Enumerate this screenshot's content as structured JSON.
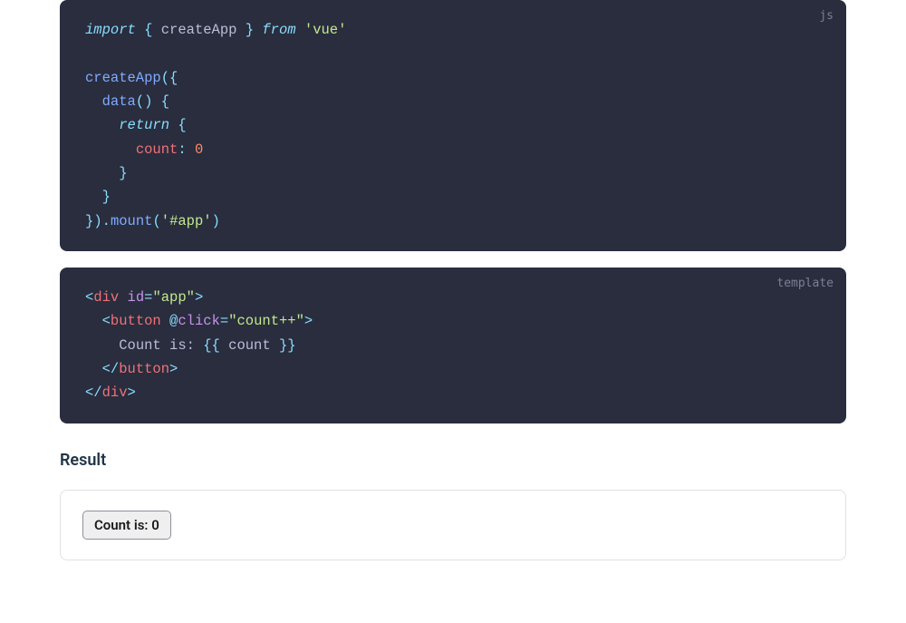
{
  "code_js": {
    "lang": "js",
    "tokens": [
      [
        [
          "import",
          " ",
          "{ ",
          "createApp",
          " }",
          " ",
          "from",
          " ",
          "'vue'"
        ],
        [
          "kw",
          "",
          "punc",
          "id",
          "punc",
          "",
          "kw",
          "",
          "str"
        ]
      ],
      [
        [
          ""
        ],
        [
          "",
          ""
        ]
      ],
      [
        [
          "createApp",
          "(",
          "{"
        ],
        [
          "fn",
          "punc",
          "punc"
        ]
      ],
      [
        [
          "  ",
          "data",
          "()",
          " ",
          "{"
        ],
        [
          "",
          "fn",
          "punc",
          "",
          "punc"
        ]
      ],
      [
        [
          "    ",
          "return",
          " ",
          "{"
        ],
        [
          "",
          "kw",
          "",
          "punc"
        ]
      ],
      [
        [
          "      ",
          "count",
          ": ",
          "0"
        ],
        [
          "",
          "prop",
          "punc",
          "num"
        ]
      ],
      [
        [
          "    ",
          "}"
        ],
        [
          "",
          "punc"
        ]
      ],
      [
        [
          "  ",
          "}"
        ],
        [
          "",
          "punc"
        ]
      ],
      [
        [
          "}",
          ")",
          ".",
          "mount",
          "(",
          "'#app'",
          ")"
        ],
        [
          "punc",
          "punc",
          "punc",
          "fn",
          "punc",
          "str",
          "punc"
        ]
      ]
    ]
  },
  "code_tpl": {
    "lang": "template",
    "tokens": [
      [
        [
          "<",
          "div",
          " ",
          "id",
          "=",
          "\"app\"",
          ">"
        ],
        [
          "ang",
          "tag",
          "",
          "attr",
          "punc",
          "str",
          "ang"
        ]
      ],
      [
        [
          "  ",
          "<",
          "button",
          " ",
          "@",
          "click",
          "=",
          "\"count++\"",
          ">"
        ],
        [
          "",
          "ang",
          "tag",
          "",
          "at",
          "attr",
          "punc",
          "str",
          "ang"
        ]
      ],
      [
        [
          "    ",
          "Count is: ",
          "{{",
          " count ",
          "}}"
        ],
        [
          "",
          "txt",
          "punc",
          "txt",
          "punc"
        ]
      ],
      [
        [
          "  ",
          "</",
          "button",
          ">"
        ],
        [
          "",
          "ang",
          "tag",
          "ang"
        ]
      ],
      [
        [
          "</",
          "div",
          ">"
        ],
        [
          "ang",
          "tag",
          "ang"
        ]
      ]
    ]
  },
  "result": {
    "heading": "Result",
    "button_label": "Count is: 0"
  }
}
